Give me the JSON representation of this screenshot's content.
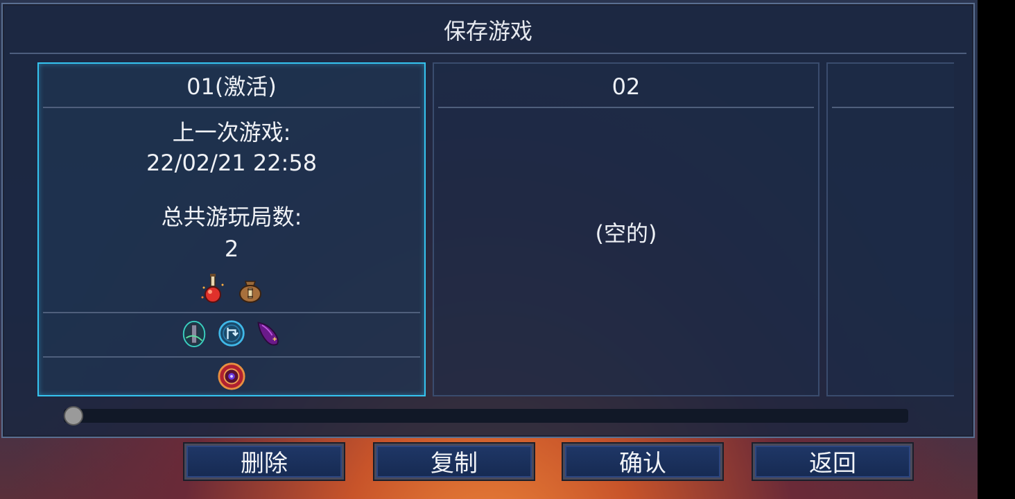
{
  "dialog": {
    "title": "保存游戏"
  },
  "slots": [
    {
      "header": "01(激活)",
      "last_played_label": "上一次游戏:",
      "last_played_value": "22/02/21 22:58",
      "runs_label": "总共游玩局数:",
      "runs_value": "2",
      "items_row1": [
        "health-flask-icon",
        "gold-bag-icon"
      ],
      "items_row2": [
        "vine-rune-icon",
        "teleport-rune-icon",
        "spider-rune-icon"
      ],
      "items_row3": [
        "boss-cell-icon"
      ]
    },
    {
      "header": "02",
      "empty_label": "(空的)"
    },
    {
      "header": ""
    }
  ],
  "scrollbar": {
    "position": 0
  },
  "buttons": {
    "delete": "删除",
    "copy": "复制",
    "confirm": "确认",
    "back": "返回"
  },
  "colors": {
    "active_border": "#35c4f0",
    "button_fill": "#1f3767",
    "dialog_bg": "#1a2640"
  }
}
